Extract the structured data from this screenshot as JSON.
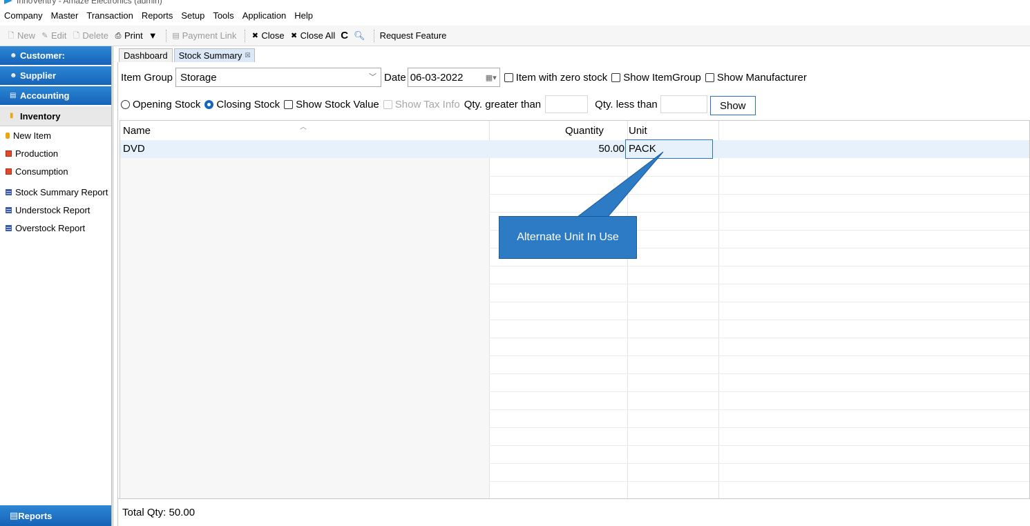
{
  "window": {
    "title": "InnoVentry - Amaze Electronics (admin)"
  },
  "menu": [
    "Company",
    "Master",
    "Transaction",
    "Reports",
    "Setup",
    "Tools",
    "Application",
    "Help"
  ],
  "toolbar": {
    "new": "New",
    "edit": "Edit",
    "delete": "Delete",
    "print": "Print",
    "payment_link": "Payment Link",
    "close": "Close",
    "close_all": "Close All",
    "request_feature": "Request Feature"
  },
  "sidebar": {
    "customer": "Customer:",
    "supplier": "Supplier",
    "accounting": "Accounting",
    "inventory": "Inventory",
    "items": [
      "New Item",
      "Production",
      "Consumption",
      "Stock Summary Report",
      "Understock Report",
      "Overstock Report"
    ],
    "reports": "Reports"
  },
  "tabs": {
    "dashboard": "Dashboard",
    "stock_summary": "Stock Summary"
  },
  "filters": {
    "item_group_label": "Item Group",
    "item_group_value": "Storage",
    "date_label": "Date",
    "date_value": "06-03-2022",
    "zero_stock": "Item with zero stock",
    "show_item_group": "Show ItemGroup",
    "show_manufacturer": "Show Manufacturer",
    "opening_stock": "Opening Stock",
    "closing_stock": "Closing Stock",
    "show_stock_value": "Show Stock Value",
    "show_tax_info": "Show Tax Info",
    "qty_greater": "Qty. greater than",
    "qty_less": "Qty. less than",
    "show_button": "Show"
  },
  "grid": {
    "columns": {
      "name": "Name",
      "quantity": "Quantity",
      "unit": "Unit"
    },
    "rows": [
      {
        "name": "DVD",
        "quantity": "50.00",
        "unit": "PACK"
      }
    ]
  },
  "footer": {
    "total": "Total Qty: 50.00"
  },
  "callout": {
    "text": "Alternate Unit In Use"
  },
  "colors": {
    "accent": "#1563b8",
    "callout": "#2c7bc4",
    "row_highlight": "#e6f1fb"
  }
}
